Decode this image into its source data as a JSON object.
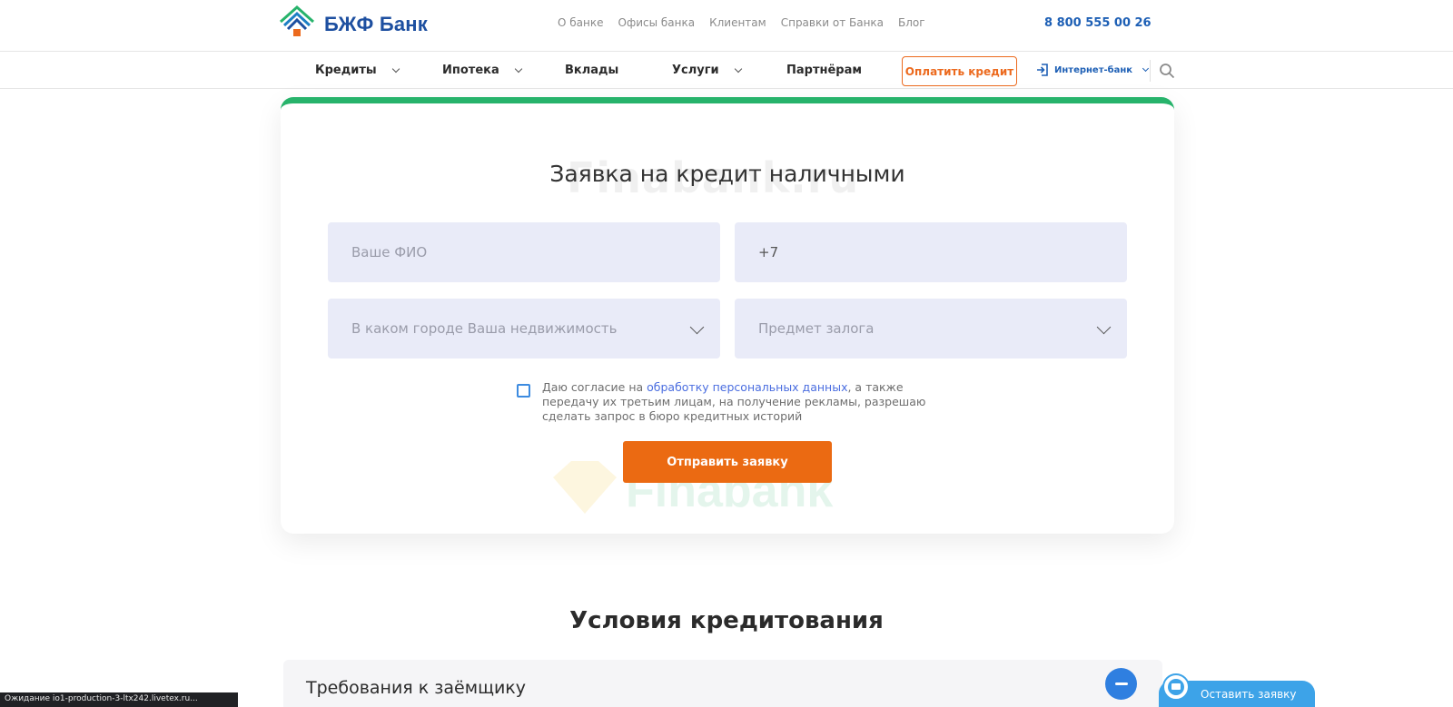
{
  "header": {
    "logo_text": "БЖФ Банк",
    "top_links": [
      "О банке",
      "Офисы банка",
      "Клиентам",
      "Справки от Банка",
      "Блог"
    ],
    "phone": "8 800 555 00 26"
  },
  "nav": {
    "credits": "Кредиты",
    "mortgage": "Ипотека",
    "deposits": "Вклады",
    "services": "Услуги",
    "partners": "Партнёрам",
    "pay_button": "Оплатить кредит",
    "internet_bank": "Интернет-банк",
    "icons": {
      "search": "search-icon",
      "login": "login-icon"
    }
  },
  "form": {
    "title": "Заявка на кредит наличными",
    "watermark": "Finabank.ru",
    "name_placeholder": "Ваше ФИО",
    "phone_value": "+7",
    "city_placeholder": "В каком городе Ваша недвижимость",
    "collateral_placeholder": "Предмет залога",
    "consent_prefix": "Даю согласие на ",
    "consent_link": "обработку персональных данных",
    "consent_suffix": ", а также передачу их третьим лицам, на получение рекламы, разрешаю сделать запрос в бюро кредитных историй",
    "submit": "Отправить заявку",
    "watermark_logo": "Finabank"
  },
  "conditions": {
    "title": "Условия кредитования",
    "accordion_title": "Требования к заёмщику"
  },
  "status_bar": "Ожидание io1-production-3-ltx242.livetex.ru...",
  "chat": {
    "label": "Оставить заявку"
  },
  "colors": {
    "brand_blue": "#1d4fa0",
    "accent_orange": "#eb6a12",
    "accent_green": "#27b36b",
    "field_bg": "#e9ebf8"
  }
}
